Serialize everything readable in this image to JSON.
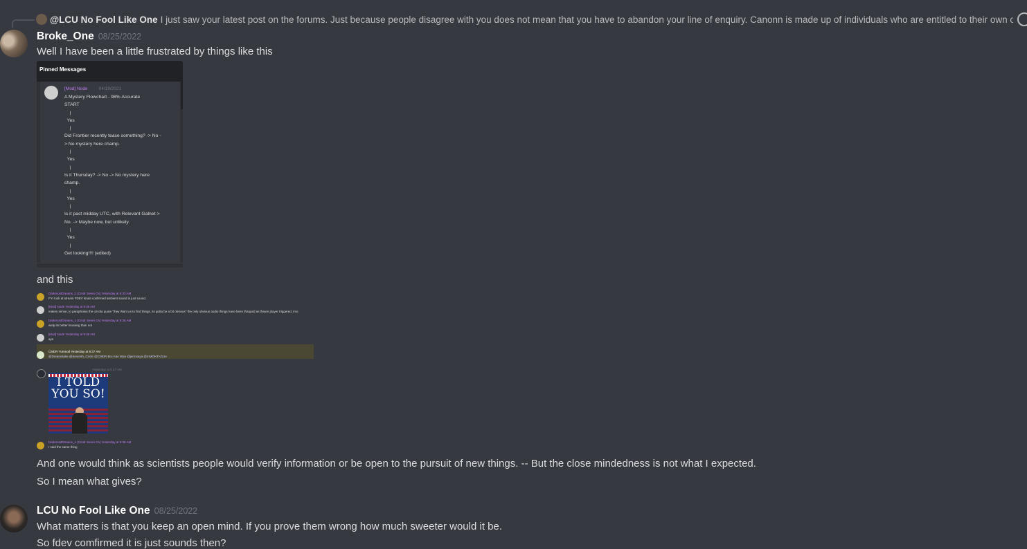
{
  "reply": {
    "mention": "@LCU No Fool Like One",
    "text": "I just saw your latest post on the forums. Just because people disagree with you does not mean that you have to abandon your line of enquiry.   Canonn is made up of individuals who are entitled to their own opinions v"
  },
  "message1": {
    "username": "Broke_One",
    "timestamp": "08/25/2022",
    "line1": "Well I have been a little frustrated by things like this",
    "pinned": {
      "header": "Pinned Messages",
      "author": "[Mod] Node",
      "date": "04/19/2021",
      "body": "A Mystery Flowchart - 98% Accurate\nSTART\n    |\n  Yes\n    |\nDid Frontier recently tease something? -> No -\n> No mystery here champ.\n    |\n  Yes\n    |\nIs it Thursday? -> No -> No mystery here\nchamp.\n    |\n  Yes\n    |\nIs it past midday UTC, with Relevant Galnet->\nNo. -> Maybe now, but unlikely.\n    |\n  Yes\n    |\nGet looking!!!! (edited)"
    },
    "line2": "and this",
    "screenshot": {
      "rows": [
        {
          "name": "DarkmostDreams_1 (Cmdr Seren Ox)  Yesterday at 9:33 AM",
          "text": "FYI look at stream FDEV kinda confirmed ambient sound is just sound."
        },
        {
          "name": "[Mod] Node  Yesterday at 9:35 AM",
          "text": "makes sense, to paraphrase the ozvola quote \"they Want us to find things, its gotta be a bit obvious\" the only obvious audio things have been thargoid as theyre player triggered, imo"
        },
        {
          "name": "DarkmostDreams_1 (Cmdr Seren Ox)  Yesterday at 9:35 AM",
          "text": "welp its better knowing than not"
        },
        {
          "name": "[Mod] Node  Yesterday at 9:36 AM",
          "text": "aye"
        },
        {
          "name": "CMDR Yumeod  Yesterday at 9:37 AM",
          "text": "@Dreamslake @Seventh_Circle @CMDR Bro Kan Wan @jermsaya @mMONTAGUe"
        },
        {
          "name": "Yesterday at 9:37 AM",
          "text": ""
        },
        {
          "name": "DarkmostDreams_1 (Cmdr Seren Ox)  Yesterday at 9:38 AM",
          "text": "I said the same thing"
        }
      ],
      "image_text": "I TOLD YOU SO!"
    },
    "line3": "And one would think as scientists people would verify information or be open to the pursuit of new things. -- But the close mindedness is not what I expected.",
    "line4": "So I mean what gives?"
  },
  "message2": {
    "username": "LCU No Fool Like One",
    "timestamp": "08/25/2022",
    "line1": "What matters is that you keep an open mind. If you prove them wrong how much sweeter would it be.",
    "line2": "So fdev comfirmed it is just sounds then?"
  },
  "colors": {
    "background": "#36393f",
    "text": "#dcddde",
    "username": "#ffffff",
    "timestamp": "#72767d",
    "mod_role": "#c27cf5"
  }
}
